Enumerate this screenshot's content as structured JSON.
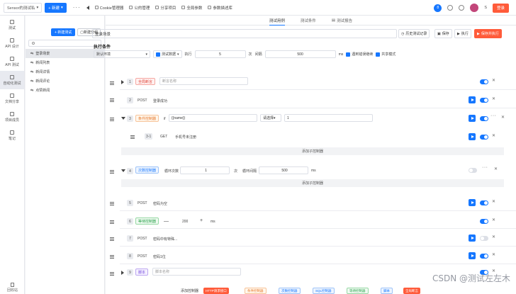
{
  "topbar": {
    "project": "Sensor的测试私",
    "new_label": "+ 新建",
    "nav": [
      "Cookie管理器",
      "公的管理",
      "分享项目",
      "全局参数",
      "参数描述库"
    ],
    "notif_badge": "8",
    "user_initial": "S",
    "login_label": "登录"
  },
  "leftnav": {
    "items": [
      "测试",
      "API 设计",
      "API 测试",
      "自动化测试",
      "文档分享",
      "项目成员",
      "笔记"
    ],
    "active": "自动化测试",
    "bottom": "回收站"
  },
  "tree": {
    "new_test": "+ 新建测试",
    "new_group": "新建分组",
    "items": [
      "登录场景",
      "新闻列表",
      "新闻详情",
      "新闻评论",
      "点赞新闻"
    ]
  },
  "tabs": [
    "测试用例",
    "测试条件",
    "测试报告"
  ],
  "active_tab": "测试用例",
  "title": {
    "value": "登录场景",
    "history": "历史测试记录",
    "save": "保存",
    "run": "执行",
    "save_run": "保存并执行"
  },
  "exec": {
    "heading": "执行条件",
    "env": "默认环境",
    "test_data": "测试数据",
    "run_label": "执行",
    "times": "5",
    "times_unit": "次",
    "interval_label": "间隔",
    "interval": "500",
    "interval_unit": "ms",
    "error_continue": "遇到错误继续",
    "shared_mode": "共享模式"
  },
  "steps": {
    "s1_idx": "1",
    "s1_tag": "全局断言",
    "s1_placeholder": "断言名称",
    "s2_idx": "2",
    "s2_method": "POST",
    "s2_name": "登录成功",
    "s3_idx": "3",
    "s3_tag": "条件控制器",
    "s3_if": "if",
    "s3_var": "{{name}}",
    "s3_op": "请选择",
    "s3_val": "1",
    "s31_idx": "3-1",
    "s31_method": "GET",
    "s31_name": "手机号未注册",
    "add_child": "添加子控制器",
    "s4_idx": "4",
    "s4_tag": "次数控制器",
    "s4_loop_label": "循环次数",
    "s4_loop": "1",
    "s4_loop_unit": "次",
    "s4_int_label": "循环间隔",
    "s4_int": "500",
    "s4_int_unit": "ms",
    "s5_idx": "5",
    "s5_method": "POST",
    "s5_name": "密码为空",
    "s6_idx": "6",
    "s6_tag": "等待控制器",
    "s6_val": "200",
    "s6_unit": "ms",
    "s7_idx": "7",
    "s7_method": "POST",
    "s7_name": "密码中有特殊...",
    "s8_idx": "8",
    "s8_method": "POST",
    "s8_name": "密码1位",
    "s9_idx": "9",
    "s9_tag": "脚本",
    "s9_placeholder": "脚本名称"
  },
  "footer": {
    "label": "添加控制器",
    "buttons": [
      "HTTP请求接口",
      "条件控制器",
      "次数控制器",
      "SQL控制器",
      "等待控制器",
      "脚本",
      "全局断言"
    ]
  },
  "watermark": "CSDN @测试左左木"
}
